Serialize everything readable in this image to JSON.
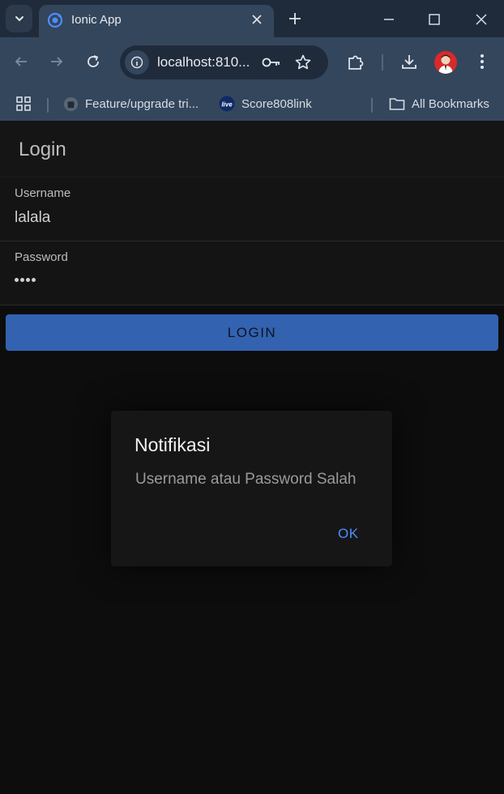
{
  "browser": {
    "tab_title": "Ionic App",
    "url": "localhost:810...",
    "bookmarks": [
      {
        "label": "Feature/upgrade tri..."
      },
      {
        "label": "Score808link"
      }
    ],
    "all_bookmarks_label": "All Bookmarks",
    "accent_color": "#34465c"
  },
  "app": {
    "header_title": "Login",
    "username": {
      "label": "Username",
      "value": "lalala"
    },
    "password": {
      "label": "Password",
      "value_masked": "••••"
    },
    "login_button": "LOGIN",
    "primary_color": "#3362b0"
  },
  "alert": {
    "title": "Notifikasi",
    "message": "Username atau Password Salah",
    "ok_button": "OK"
  }
}
